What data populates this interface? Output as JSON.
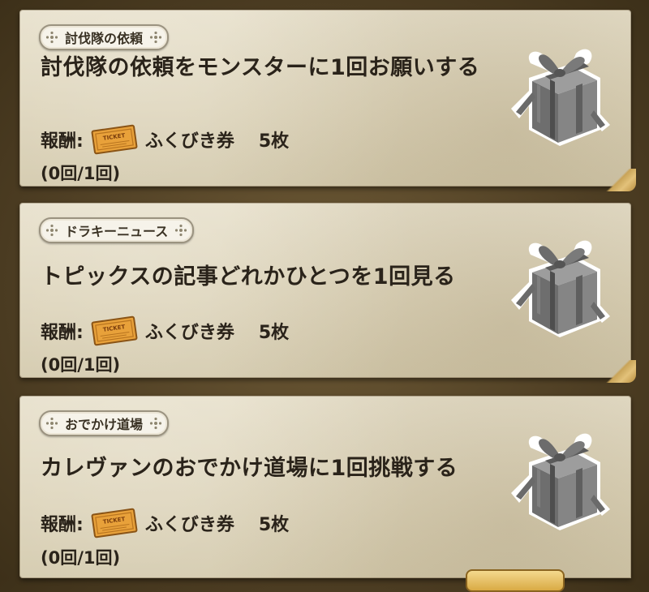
{
  "missions": [
    {
      "category": "討伐隊の依頼",
      "title": "討伐隊の依頼をモンスターに1回お願いする",
      "reward_label": "報酬:",
      "reward_item": "ふくびき券",
      "reward_qty": "5枚",
      "progress": "(0回/1回)",
      "icon": "gift-box-icon"
    },
    {
      "category": "ドラキーニュース",
      "title": "トピックスの記事どれかひとつを1回見る",
      "reward_label": "報酬:",
      "reward_item": "ふくびき券",
      "reward_qty": "5枚",
      "progress": "(0回/1回)",
      "icon": "gift-box-icon"
    },
    {
      "category": "おでかけ道場",
      "title": "カレヴァンのおでかけ道場に1回挑戦する",
      "reward_label": "報酬:",
      "reward_item": "ふくびき券",
      "reward_qty": "5枚",
      "progress": "(0回/1回)",
      "icon": "gift-box-icon"
    }
  ],
  "colors": {
    "background": "#5b4a2c",
    "card": "#e2dac2",
    "text": "#2a231a",
    "ticket": "#e3a43b"
  }
}
